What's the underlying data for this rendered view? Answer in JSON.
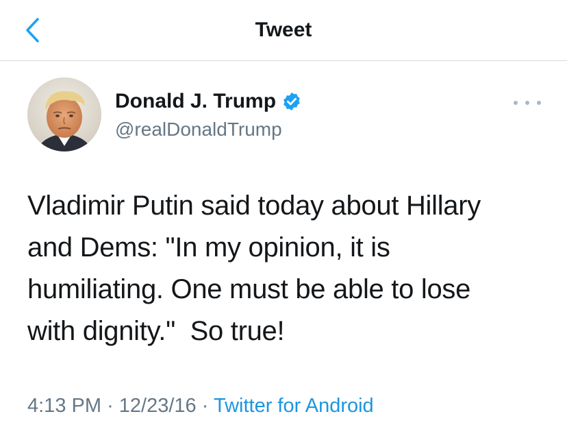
{
  "nav": {
    "title": "Tweet"
  },
  "tweet": {
    "author_name": "Donald J. Trump",
    "author_handle": "@realDonaldTrump",
    "verified": true,
    "text_lines": [
      "Vladimir Putin said today about Hillary",
      "and Dems: \"In my opinion, it is",
      "humiliating. One must be able to lose",
      "with dignity.\"  So true!"
    ],
    "time": "4:13 PM",
    "separator": "·",
    "date": "12/23/16",
    "source": "Twitter for Android"
  },
  "icons": {
    "back": "chevron-left-icon",
    "verified": "verified-badge-icon",
    "more": "more-dots-icon"
  },
  "colors": {
    "accent": "#1da1f2",
    "text": "#14171a",
    "muted": "#657786",
    "link": "#1b95e0"
  }
}
